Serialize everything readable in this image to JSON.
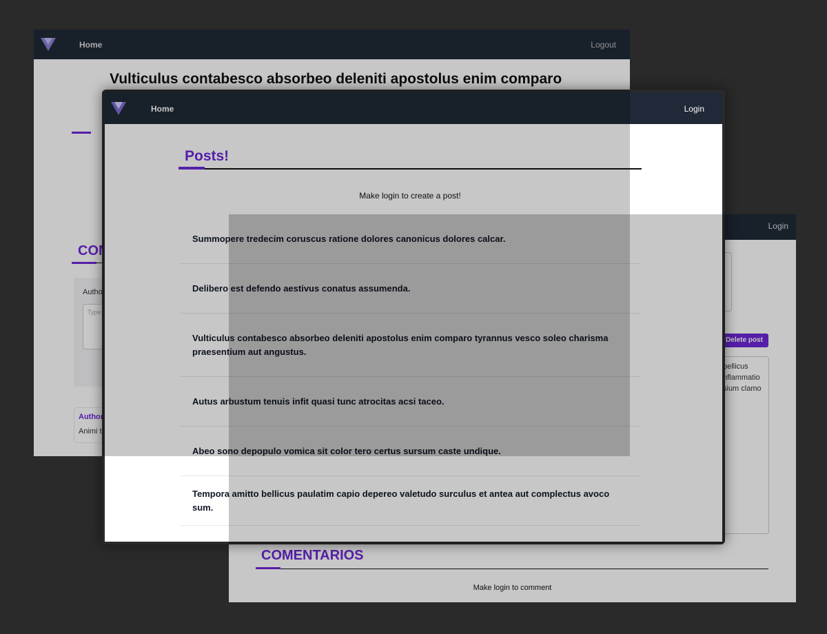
{
  "back_left": {
    "nav": {
      "home": "Home",
      "logout": "Logout"
    },
    "post_title": "Vulticulus contabesco absorbeo deleniti apostolus enim comparo",
    "comments_heading_partial": "COM",
    "author_label": "Autho",
    "textarea_placeholder": "Type",
    "comment_author": "Author",
    "comment_text": "Animi t"
  },
  "back_right": {
    "nav": {
      "login": "Login"
    },
    "delete_button": "Delete post",
    "body_lines": [
      "pellicus",
      "nflammatio",
      "sium clamo"
    ],
    "comments_heading": "COMENTARIOS",
    "login_to_comment": "Make login to comment"
  },
  "front": {
    "nav": {
      "home": "Home",
      "login": "Login"
    },
    "heading": "Posts!",
    "login_prompt": "Make login to create a post!",
    "posts": [
      "Summopere tredecim coruscus ratione dolores canonicus dolores calcar.",
      "Delibero est defendo aestivus conatus assumenda.",
      "Vulticulus contabesco absorbeo deleniti apostolus enim comparo tyrannus vesco soleo charisma praesentium aut angustus.",
      "Autus arbustum tenuis infit quasi tunc atrocitas acsi taceo.",
      "Abeo sono depopulo vomica sit color tero certus sursum caste undique.",
      "Tempora amitto bellicus paulatim capio depereo valetudo surculus et antea aut complectus avoco sum."
    ]
  },
  "colors": {
    "accent": "#6d28d9",
    "nav_bg": "#1f2937",
    "backdrop": "#2a2a2a"
  },
  "icons": {
    "logo": "vue-logo-icon"
  }
}
